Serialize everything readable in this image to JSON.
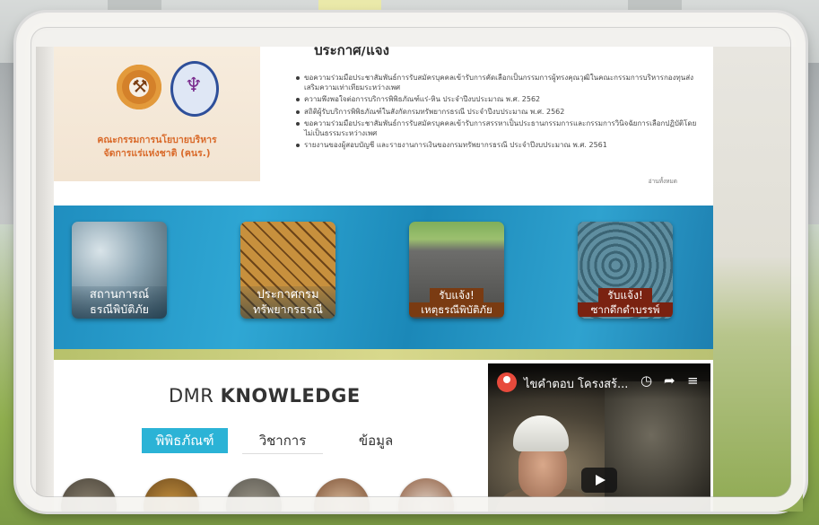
{
  "org": {
    "name_line1": "คณะกรรมการนโยบายบริหาร",
    "name_line2": "จัดการแร่แห่งชาติ (คนร.)"
  },
  "news": {
    "title": "ประกาศ/แจ้ง",
    "items": [
      "ขอความร่วมมือประชาสัมพันธ์การรับสมัครบุคคลเข้ารับการคัดเลือกเป็นกรรมการผู้ทรงคุณวุฒิในคณะกรรมการบริหารกองทุนส่งเสริมความเท่าเทียมระหว่างเพศ",
      "ความพึงพอใจต่อการบริการพิพิธภัณฑ์แร่-หิน ประจำปีงบประมาณ พ.ศ. 2562",
      "สถิติผู้รับบริการพิพิธภัณฑ์ในสังกัดกรมทรัพยากรธรณี ประจำปีงบประมาณ พ.ศ. 2562",
      "ขอความร่วมมือประชาสัมพันธ์การรับสมัครบุคคลเข้ารับการสรรหาเป็นประธานกรรมการและกรรมการวินิจฉัยการเลือกปฏิบัติโดยไม่เป็นธรรมระหว่างเพศ",
      "รายงานของผู้สอบบัญชี และรายงานการเงินของกรมทรัพยากรธรณี ประจำปีงบประมาณ พ.ศ. 2561"
    ],
    "more": "อ่านทั้งหมด"
  },
  "tiles": [
    {
      "line1": "สถานการณ์",
      "line2": "ธรณีพิบัติภัย"
    },
    {
      "line1": "ประกาศกรม",
      "line2": "ทรัพยากรธรณี"
    },
    {
      "line1": "รับแจ้ง!",
      "line2": "เหตุธรณีพิบัติภัย"
    },
    {
      "line1": "รับแจ้ง!",
      "line2": "ซากดึกดำบรรพ์"
    }
  ],
  "knowledge": {
    "title_prefix": "DMR",
    "title_bold": "KNOWLEDGE",
    "tabs": [
      "พิพิธภัณฑ์",
      "วิชาการ",
      "ข้อมูล"
    ]
  },
  "video": {
    "title": "ไขคำตอบ โครงสร้...",
    "icons": [
      "clock-icon",
      "share-icon",
      "playlist-icon",
      "play-icon"
    ]
  },
  "colors": {
    "tile_band": "#2fa7d4",
    "tab_active": "#2bb3d6",
    "org_name": "#d96a2a",
    "label_box": "#7a3b12"
  }
}
